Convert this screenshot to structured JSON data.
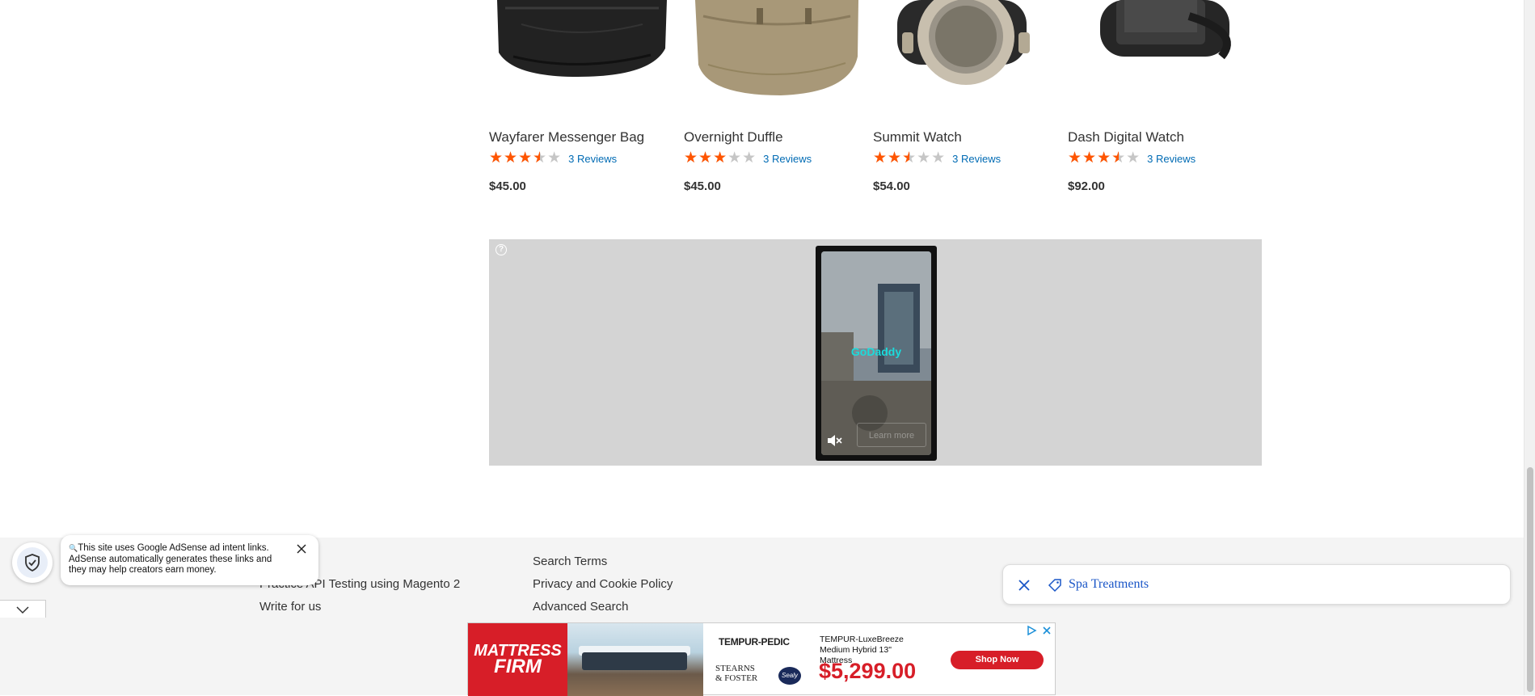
{
  "products": [
    {
      "name": "Wayfarer Messenger Bag",
      "rating_percent": 70,
      "reviews": "3 Reviews",
      "price": "$45.00",
      "icon": "messenger-bag-image"
    },
    {
      "name": "Overnight Duffle",
      "rating_percent": 60,
      "reviews": "3 Reviews",
      "price": "$45.00",
      "icon": "duffle-bag-image"
    },
    {
      "name": "Summit Watch",
      "rating_percent": 50,
      "reviews": "3 Reviews",
      "price": "$54.00",
      "icon": "summit-watch-image"
    },
    {
      "name": "Dash Digital Watch",
      "rating_percent": 70,
      "reviews": "3 Reviews",
      "price": "$92.00",
      "icon": "digital-watch-image"
    }
  ],
  "stars_glyphs": "★★★★★",
  "video_ad": {
    "brand": "GoDaddy",
    "button": "Learn more"
  },
  "footer": {
    "col1": [
      "Practice API Testing using Magento 2",
      "Write for us"
    ],
    "col2": [
      "Search Terms",
      "Privacy and Cookie Policy",
      "Advanced Search"
    ]
  },
  "adsense_notice": {
    "text": "This site uses Google AdSense ad intent links. AdSense automatically generates these links and they may help creators earn money."
  },
  "search_chip": {
    "label": "Spa Treatments"
  },
  "banner_ad": {
    "logo_line1": "MATTRESS",
    "logo_line2": "FIRM",
    "brand1": "TEMPUR-PEDIC",
    "brand2_line1": "STEARNS",
    "brand2_line2": "& FOSTER",
    "brand3": "Sealy",
    "product": "TEMPUR-LuxeBreeze Medium Hybrid 13\" Mattress",
    "price": "$5,299.00",
    "cta": "Shop Now"
  },
  "colors": {
    "star_fill": "#ff5501",
    "link": "#006bb4",
    "brand_red": "#d71e28",
    "godaddy_teal": "#1bdbdb"
  }
}
